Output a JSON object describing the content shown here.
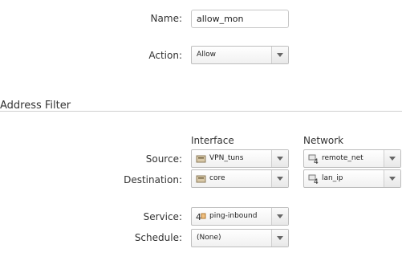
{
  "general": {
    "name_label": "Name:",
    "name_value": "allow_mon",
    "action_label": "Action:",
    "action_value": "Allow"
  },
  "address_filter": {
    "section_title": "Address Filter",
    "col_interface": "Interface",
    "col_network": "Network",
    "source_label": "Source:",
    "source_interface": "VPN_tuns",
    "source_network": "remote_net",
    "destination_label": "Destination:",
    "destination_interface": "core",
    "destination_network": "lan_ip"
  },
  "service": {
    "service_label": "Service:",
    "service_value": "ping-inbound",
    "schedule_label": "Schedule:",
    "schedule_value": "(None)"
  },
  "icons": {
    "interface": "interface-icon",
    "network_object": "address-object-icon",
    "service": "service-object-icon"
  },
  "colors": {
    "border": "#c6c6c6",
    "divider": "#cfcfcf",
    "text": "#333333"
  }
}
